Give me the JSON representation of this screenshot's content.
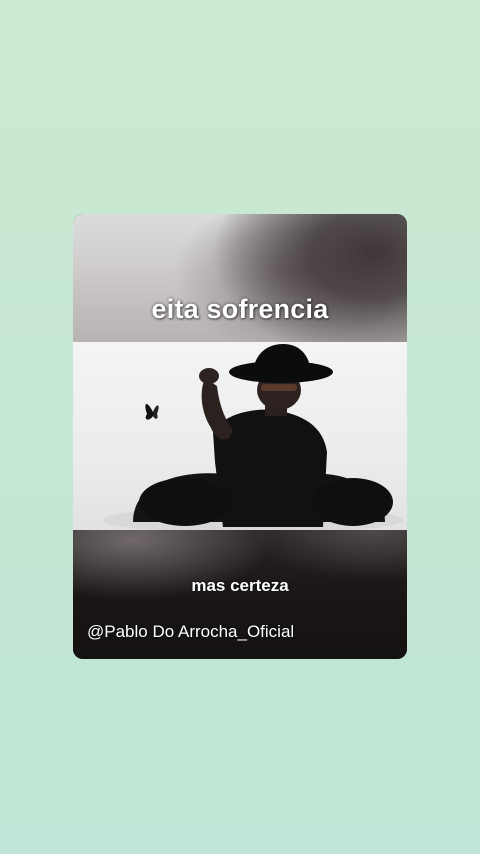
{
  "video_card": {
    "top_caption": "eita sofrencia",
    "bottom_caption": "mas certeza",
    "watermark_handle": "@Pablo Do Arrocha_Oficial"
  },
  "icons": {
    "butterfly": "butterfly-icon"
  },
  "colors": {
    "background": "#c6e7d3",
    "card_dark": "#1a1616",
    "caption_text": "#ffffff"
  }
}
